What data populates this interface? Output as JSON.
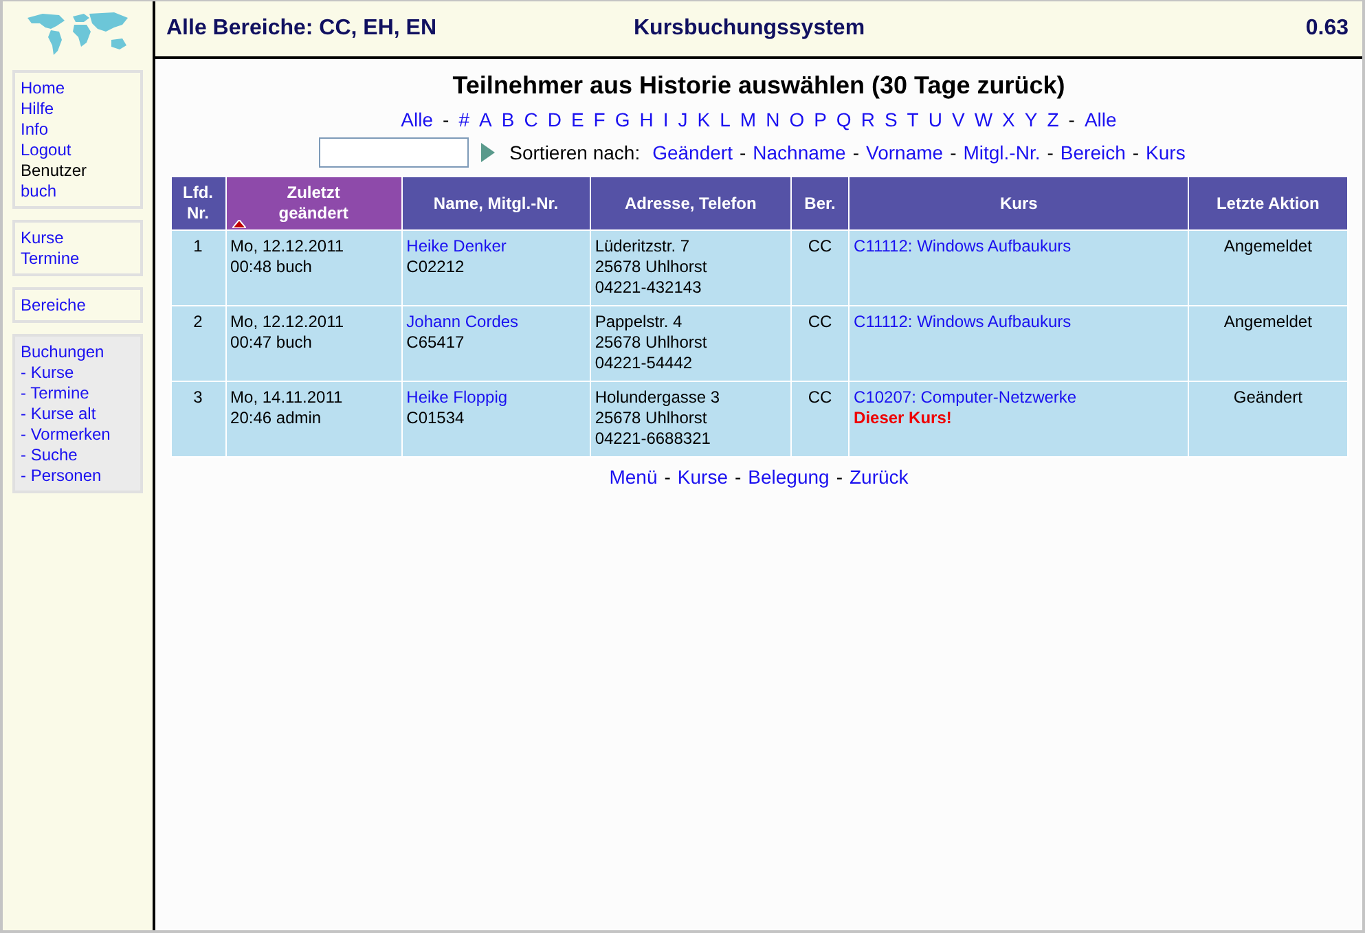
{
  "header": {
    "scope": "Alle Bereiche: CC, EH, EN",
    "title": "Kursbuchungssystem",
    "version": "0.63"
  },
  "sidebar": {
    "groups": [
      {
        "shaded": false,
        "items": [
          {
            "label": "Home",
            "kind": "link"
          },
          {
            "label": "Hilfe",
            "kind": "link"
          },
          {
            "label": "Info",
            "kind": "link"
          },
          {
            "label": "Logout",
            "kind": "link"
          },
          {
            "label": "Benutzer",
            "kind": "text"
          },
          {
            "label": "buch",
            "kind": "link"
          }
        ]
      },
      {
        "shaded": false,
        "items": [
          {
            "label": "Kurse",
            "kind": "link"
          },
          {
            "label": "Termine",
            "kind": "link"
          }
        ]
      },
      {
        "shaded": false,
        "items": [
          {
            "label": "Bereiche",
            "kind": "link"
          }
        ]
      },
      {
        "shaded": true,
        "items": [
          {
            "label": "Buchungen",
            "kind": "link"
          },
          {
            "label": "- Kurse",
            "kind": "link"
          },
          {
            "label": "- Termine",
            "kind": "link"
          },
          {
            "label": "- Kurse alt",
            "kind": "link"
          },
          {
            "label": "- Vormerken",
            "kind": "link"
          },
          {
            "label": "- Suche",
            "kind": "link"
          },
          {
            "label": "- Personen",
            "kind": "link"
          }
        ]
      }
    ]
  },
  "page_title": "Teilnehmer aus Historie auswählen (30 Tage zurück)",
  "alphabet": [
    {
      "label": "Alle",
      "kind": "link"
    },
    {
      "label": "-",
      "kind": "separator"
    },
    {
      "label": "#",
      "kind": "link"
    },
    {
      "label": "A",
      "kind": "link"
    },
    {
      "label": "B",
      "kind": "link"
    },
    {
      "label": "C",
      "kind": "link"
    },
    {
      "label": "D",
      "kind": "link"
    },
    {
      "label": "E",
      "kind": "link"
    },
    {
      "label": "F",
      "kind": "link"
    },
    {
      "label": "G",
      "kind": "link"
    },
    {
      "label": "H",
      "kind": "link"
    },
    {
      "label": "I",
      "kind": "link"
    },
    {
      "label": "J",
      "kind": "link"
    },
    {
      "label": "K",
      "kind": "link"
    },
    {
      "label": "L",
      "kind": "link"
    },
    {
      "label": "M",
      "kind": "link"
    },
    {
      "label": "N",
      "kind": "link"
    },
    {
      "label": "O",
      "kind": "link"
    },
    {
      "label": "P",
      "kind": "link"
    },
    {
      "label": "Q",
      "kind": "link"
    },
    {
      "label": "R",
      "kind": "link"
    },
    {
      "label": "S",
      "kind": "link"
    },
    {
      "label": "T",
      "kind": "link"
    },
    {
      "label": "U",
      "kind": "link"
    },
    {
      "label": "V",
      "kind": "link"
    },
    {
      "label": "W",
      "kind": "link"
    },
    {
      "label": "X",
      "kind": "link"
    },
    {
      "label": "Y",
      "kind": "link"
    },
    {
      "label": "Z",
      "kind": "link"
    },
    {
      "label": "-",
      "kind": "separator"
    },
    {
      "label": "Alle",
      "kind": "link"
    }
  ],
  "sort": {
    "label": "Sortieren nach:",
    "options": [
      {
        "label": "Geändert",
        "kind": "link"
      },
      {
        "label": "-",
        "kind": "separator"
      },
      {
        "label": "Nachname",
        "kind": "link"
      },
      {
        "label": "-",
        "kind": "separator"
      },
      {
        "label": "Vorname",
        "kind": "link"
      },
      {
        "label": "-",
        "kind": "separator"
      },
      {
        "label": "Mitgl.-Nr.",
        "kind": "link"
      },
      {
        "label": "-",
        "kind": "separator"
      },
      {
        "label": "Bereich",
        "kind": "link"
      },
      {
        "label": "-",
        "kind": "separator"
      },
      {
        "label": "Kurs",
        "kind": "link"
      }
    ]
  },
  "table": {
    "columns": [
      {
        "label": "Lfd. Nr.",
        "sorted": false
      },
      {
        "label": "Zuletzt geändert",
        "sorted": true
      },
      {
        "label": "Name, Mitgl.-Nr.",
        "sorted": false
      },
      {
        "label": "Adresse, Telefon",
        "sorted": false
      },
      {
        "label": "Ber.",
        "sorted": false
      },
      {
        "label": "Kurs",
        "sorted": false
      },
      {
        "label": "Letzte Aktion",
        "sorted": false
      }
    ],
    "rows": [
      {
        "nr": "1",
        "changed": [
          "Mo, 12.12.2011",
          "00:48 buch"
        ],
        "name": "Heike Denker",
        "member_no": "C02212",
        "address": [
          "Lüderitzstr. 7",
          "25678 Uhlhorst",
          "04221-432143"
        ],
        "area": "CC",
        "course": "C11112: Windows Aufbaukurs",
        "action": "Angemeldet"
      },
      {
        "nr": "2",
        "changed": [
          "Mo, 12.12.2011",
          "00:47 buch"
        ],
        "name": "Johann Cordes",
        "member_no": "C65417",
        "address": [
          "Pappelstr. 4",
          "25678 Uhlhorst",
          "04221-54442"
        ],
        "area": "CC",
        "course": "C11112: Windows Aufbaukurs",
        "action": "Angemeldet"
      },
      {
        "nr": "3",
        "changed": [
          "Mo, 14.11.2011",
          "20:46 admin"
        ],
        "name": "Heike Floppig",
        "member_no": "C01534",
        "address": [
          "Holundergasse 3",
          "25678 Uhlhorst",
          "04221-6688321"
        ],
        "area": "CC",
        "course": "C10207: Computer-Netzwerke",
        "note": "Dieser Kurs!",
        "action": "Geändert"
      }
    ]
  },
  "footer": [
    {
      "label": "Menü",
      "kind": "link"
    },
    {
      "label": "-",
      "kind": "separator"
    },
    {
      "label": "Kurse",
      "kind": "link"
    },
    {
      "label": "-",
      "kind": "separator"
    },
    {
      "label": "Belegung",
      "kind": "link"
    },
    {
      "label": "-",
      "kind": "separator"
    },
    {
      "label": "Zurück",
      "kind": "link"
    }
  ]
}
